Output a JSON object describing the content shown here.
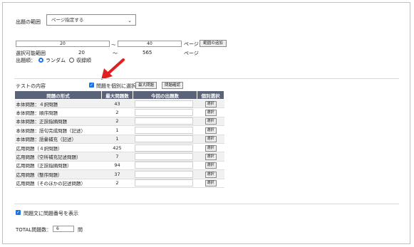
{
  "range": {
    "label": "出題の範囲",
    "select_value": "ページ指定する",
    "from_value": "20",
    "tilde": "〜",
    "to_value": "40",
    "page_unit": "ページ",
    "add_range_button": "範囲の追加",
    "selectable_label": "選択可能範囲",
    "selectable_min": "20",
    "selectable_tilde": "〜",
    "selectable_max": "565",
    "selectable_unit": "ページ"
  },
  "order": {
    "label": "出題順：",
    "random": "ランダム",
    "sequential": "収録順",
    "selected": "random"
  },
  "test": {
    "section_label": "テストの内容",
    "individual_select_label": "問題を個別に選択",
    "individual_select_checked": true,
    "show_max_button": "最大問題",
    "question_check_button": "問題確認"
  },
  "table": {
    "headers": [
      "問題の形式",
      "最大問題数",
      "今回の出題数",
      "個別選択"
    ],
    "select_button_label": "選択",
    "rows": [
      {
        "type": "本体問題：４択問題",
        "max": "43"
      },
      {
        "type": "本体問題：順序問題",
        "max": "2"
      },
      {
        "type": "本体問題：正誤指摘問題",
        "max": "2"
      },
      {
        "type": "本体問題：語句完成問題（記述）",
        "max": "1"
      },
      {
        "type": "本体問題：語彙補充（記述）",
        "max": "1"
      },
      {
        "type": "応用問題（４択問題）",
        "max": "425"
      },
      {
        "type": "応用問題（空所補充記述問題）",
        "max": "7"
      },
      {
        "type": "応用問題（正誤指摘問題）",
        "max": "94"
      },
      {
        "type": "応用問題（整序問題）",
        "max": "37"
      },
      {
        "type": "応用問題（そのほかの記述問題）",
        "max": "2"
      }
    ]
  },
  "footer": {
    "show_numbers_label": "問題文に問題番号を表示",
    "show_numbers_checked": true,
    "total_label": "TOTAL問題数：",
    "total_value": "6",
    "total_unit": "問"
  },
  "colors": {
    "table_header_bg": "#5b6378",
    "accent_blue": "#1a73e8",
    "arrow_red": "#e02020"
  },
  "icons": [
    "chevron-down-icon",
    "checkbox-checked-icon",
    "radio-selected-icon",
    "radio-unselected-icon",
    "red-arrow-icon"
  ]
}
